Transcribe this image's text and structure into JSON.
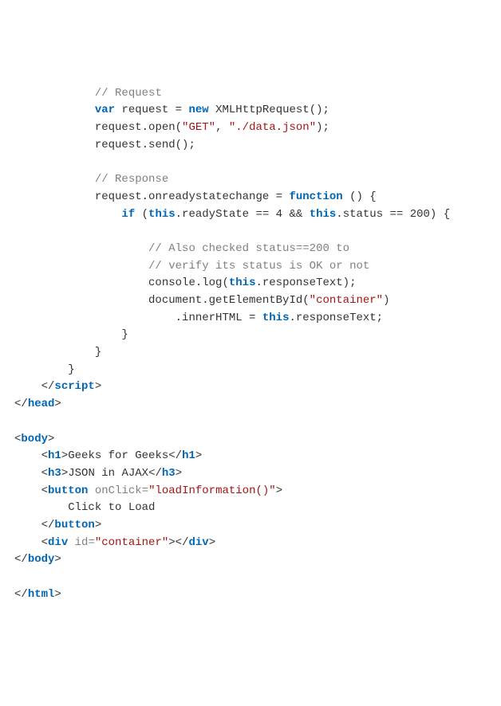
{
  "code": {
    "c1": "// Request",
    "l2a": "var",
    "l2b": " request = ",
    "l2c": "new",
    "l2d": " XMLHttpRequest();",
    "l3a": "request.open(",
    "l3b": "\"GET\"",
    "l3c": ", ",
    "l3d": "\"./data.json\"",
    "l3e": ");",
    "l4": "request.send();",
    "c2": "// Response",
    "l6a": "request.onreadystatechange = ",
    "l6b": "function",
    "l6c": " () {",
    "l7a": "if",
    "l7b": " (",
    "l7c": "this",
    "l7d": ".readyState == 4 && ",
    "l7e": "this",
    "l7f": ".status == 200) {",
    "c3": "// Also checked status==200 to",
    "c4": "// verify its status is OK or not",
    "l10a": "console.log(",
    "l10b": "this",
    "l10c": ".responseText);",
    "l11a": "document.getElementById(",
    "l11b": "\"container\"",
    "l11c": ")",
    "l12a": ".innerHTML = ",
    "l12b": "this",
    "l12c": ".responseText;",
    "br1": "}",
    "br2": "}",
    "br3": "}",
    "t_script_c": "script",
    "t_head_c": "head",
    "t_body_o": "body",
    "t_h1_o": "h1",
    "h1_text": "Geeks for Geeks",
    "t_h1_c": "h1",
    "t_h3_o": "h3",
    "h3_text": "JSON in AJAX",
    "t_h3_c": "h3",
    "t_button_o": "button",
    "attr_onclick": " onClick=",
    "onclick_val": "\"loadInformation()\"",
    "btn_text": "Click to Load",
    "t_button_c": "button",
    "t_div_o": "div",
    "attr_id": " id=",
    "id_val": "\"container\"",
    "t_div_c": "div",
    "t_body_c": "body",
    "t_html_c": "html",
    "lt": "<",
    "gt": ">",
    "ltc": "</"
  }
}
